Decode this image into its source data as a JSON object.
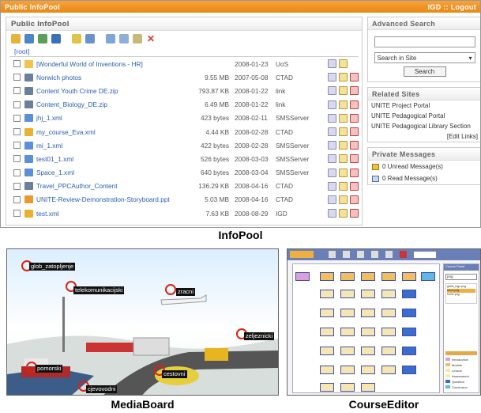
{
  "infopool": {
    "topbar": {
      "title": "Public  InfoPool",
      "right": "IGD :: Logout"
    },
    "panel_title": "Public InfoPool",
    "breadcrumb": "[root]",
    "files": [
      {
        "name": "[Wonderful World of Inventions - HR]",
        "size": "",
        "date": "2008-01-23",
        "source": "UoS",
        "type": "folder"
      },
      {
        "name": "Norwich photos",
        "size": "9.55 MB",
        "date": "2007-05-08",
        "source": "CTAD",
        "type": "package"
      },
      {
        "name": "Content Youth Crime DE.zip",
        "size": "793.87 KB",
        "date": "2008-01-22",
        "source": "link",
        "type": "package"
      },
      {
        "name": "Content_Biology_DE.zip",
        "size": "6.49 MB",
        "date": "2008-01-22",
        "source": "link",
        "type": "package"
      },
      {
        "name": "jhj_1.xml",
        "size": "423 bytes",
        "date": "2008-02-11",
        "source": "SMSServer",
        "type": "xml"
      },
      {
        "name": "my_course_Eva.xml",
        "size": "4.44 KB",
        "date": "2008-02-28",
        "source": "CTAD",
        "type": "course"
      },
      {
        "name": "mi_1.xml",
        "size": "422 bytes",
        "date": "2008-02-28",
        "source": "SMSServer",
        "type": "xml"
      },
      {
        "name": "test01_1.xml",
        "size": "526 bytes",
        "date": "2008-03-03",
        "source": "SMSServer",
        "type": "xml"
      },
      {
        "name": "Space_1.xml",
        "size": "640 bytes",
        "date": "2008-03-04",
        "source": "SMSServer",
        "type": "xml"
      },
      {
        "name": "Travel_PPCAuthor_Content",
        "size": "136.29 KB",
        "date": "2008-04-16",
        "source": "CTAD",
        "type": "package"
      },
      {
        "name": "UNITE-Review-Demonstration-Storyboard.ppt",
        "size": "5.03 MB",
        "date": "2008-04-16",
        "source": "CTAD",
        "type": "ppt"
      },
      {
        "name": "test.xml",
        "size": "7.63 KB",
        "date": "2008-08-29",
        "source": "IGD",
        "type": "course"
      }
    ],
    "search": {
      "title": "Advanced Search",
      "scope": "Search in Site",
      "button": "Search"
    },
    "related": {
      "title": "Related Sites",
      "links": [
        "UNITE Project Portal",
        "UNITE Pedagogical Portal",
        "UNITE Pedagogical Library Section"
      ],
      "edit": "[Edit Links]"
    },
    "messages": {
      "title": "Private Messages",
      "unread": "0 Unread Message(s)",
      "read": "0 Read Message(s)"
    }
  },
  "captions": {
    "infopool": "InfoPool",
    "mediaboard": "MediaBoard",
    "courseeditor": "CourseEditor"
  },
  "mediaboard": {
    "labels": [
      "glob_zatopljenje",
      "telekomunikacijski",
      "zracni",
      "zeljeznicki",
      "pomorski",
      "cestovni",
      "cjevovodni"
    ]
  },
  "courseeditor": {
    "header": "Course Panel",
    "search_value": "png",
    "files": [
      "globe_logo.png",
      "taxon.png",
      "home.png"
    ],
    "legend": [
      "Introduction",
      "Module",
      "Lesson",
      "Assessment",
      "Question",
      "Conclusion"
    ]
  }
}
